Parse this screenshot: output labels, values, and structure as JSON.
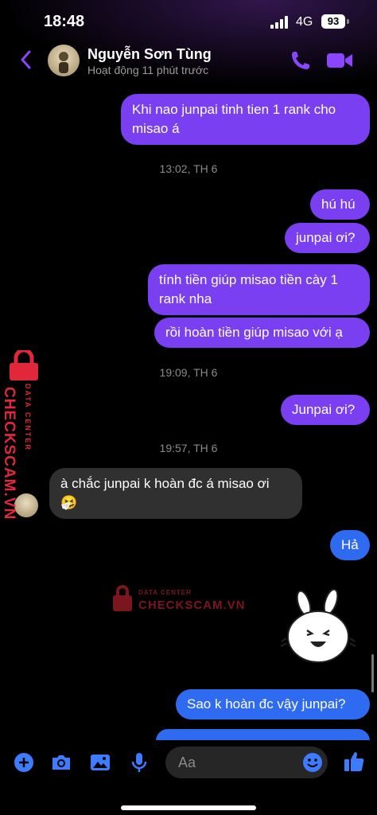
{
  "status_bar": {
    "time": "18:48",
    "network": "4G",
    "battery": "93"
  },
  "header": {
    "contact_name": "Nguyễn Sơn Tùng",
    "activity": "Hoạt động 11 phút trước"
  },
  "messages": [
    {
      "type": "sent",
      "line1": "Khi nao junpai tinh tien 1 rank cho",
      "line2": "misao á"
    },
    {
      "type": "timestamp",
      "text": "13:02, TH 6"
    },
    {
      "type": "sent",
      "text": "hú hú"
    },
    {
      "type": "sent",
      "text": "junpai ơi?"
    },
    {
      "type": "sent",
      "line1": "tính tiền giúp misao tiền cày 1",
      "line2": "rank nha"
    },
    {
      "type": "sent",
      "text": "rồi hoàn tiền giúp misao với ạ"
    },
    {
      "type": "timestamp",
      "text": "19:09, TH 6"
    },
    {
      "type": "sent",
      "text": "Junpai ơi?"
    },
    {
      "type": "timestamp",
      "text": "19:57, TH 6"
    },
    {
      "type": "received",
      "line1": "à chắc junpai k hoàn đc á misao ơi",
      "line2": "🤧"
    },
    {
      "type": "sent",
      "text": "Hả"
    },
    {
      "type": "sticker",
      "icon": "bunny-sticker-icon"
    },
    {
      "type": "sent",
      "text": "Sao k hoàn đc vậy junpai?"
    }
  ],
  "watermark": {
    "line1": "DATA CENTER",
    "line2": "CHECKSCAM.VN"
  },
  "composer": {
    "placeholder": "Aa"
  },
  "colors": {
    "accent": "#8b45ff",
    "sent_purple": "#7a3ff0",
    "sent_blue": "#2f6bf0",
    "received": "#303030"
  }
}
